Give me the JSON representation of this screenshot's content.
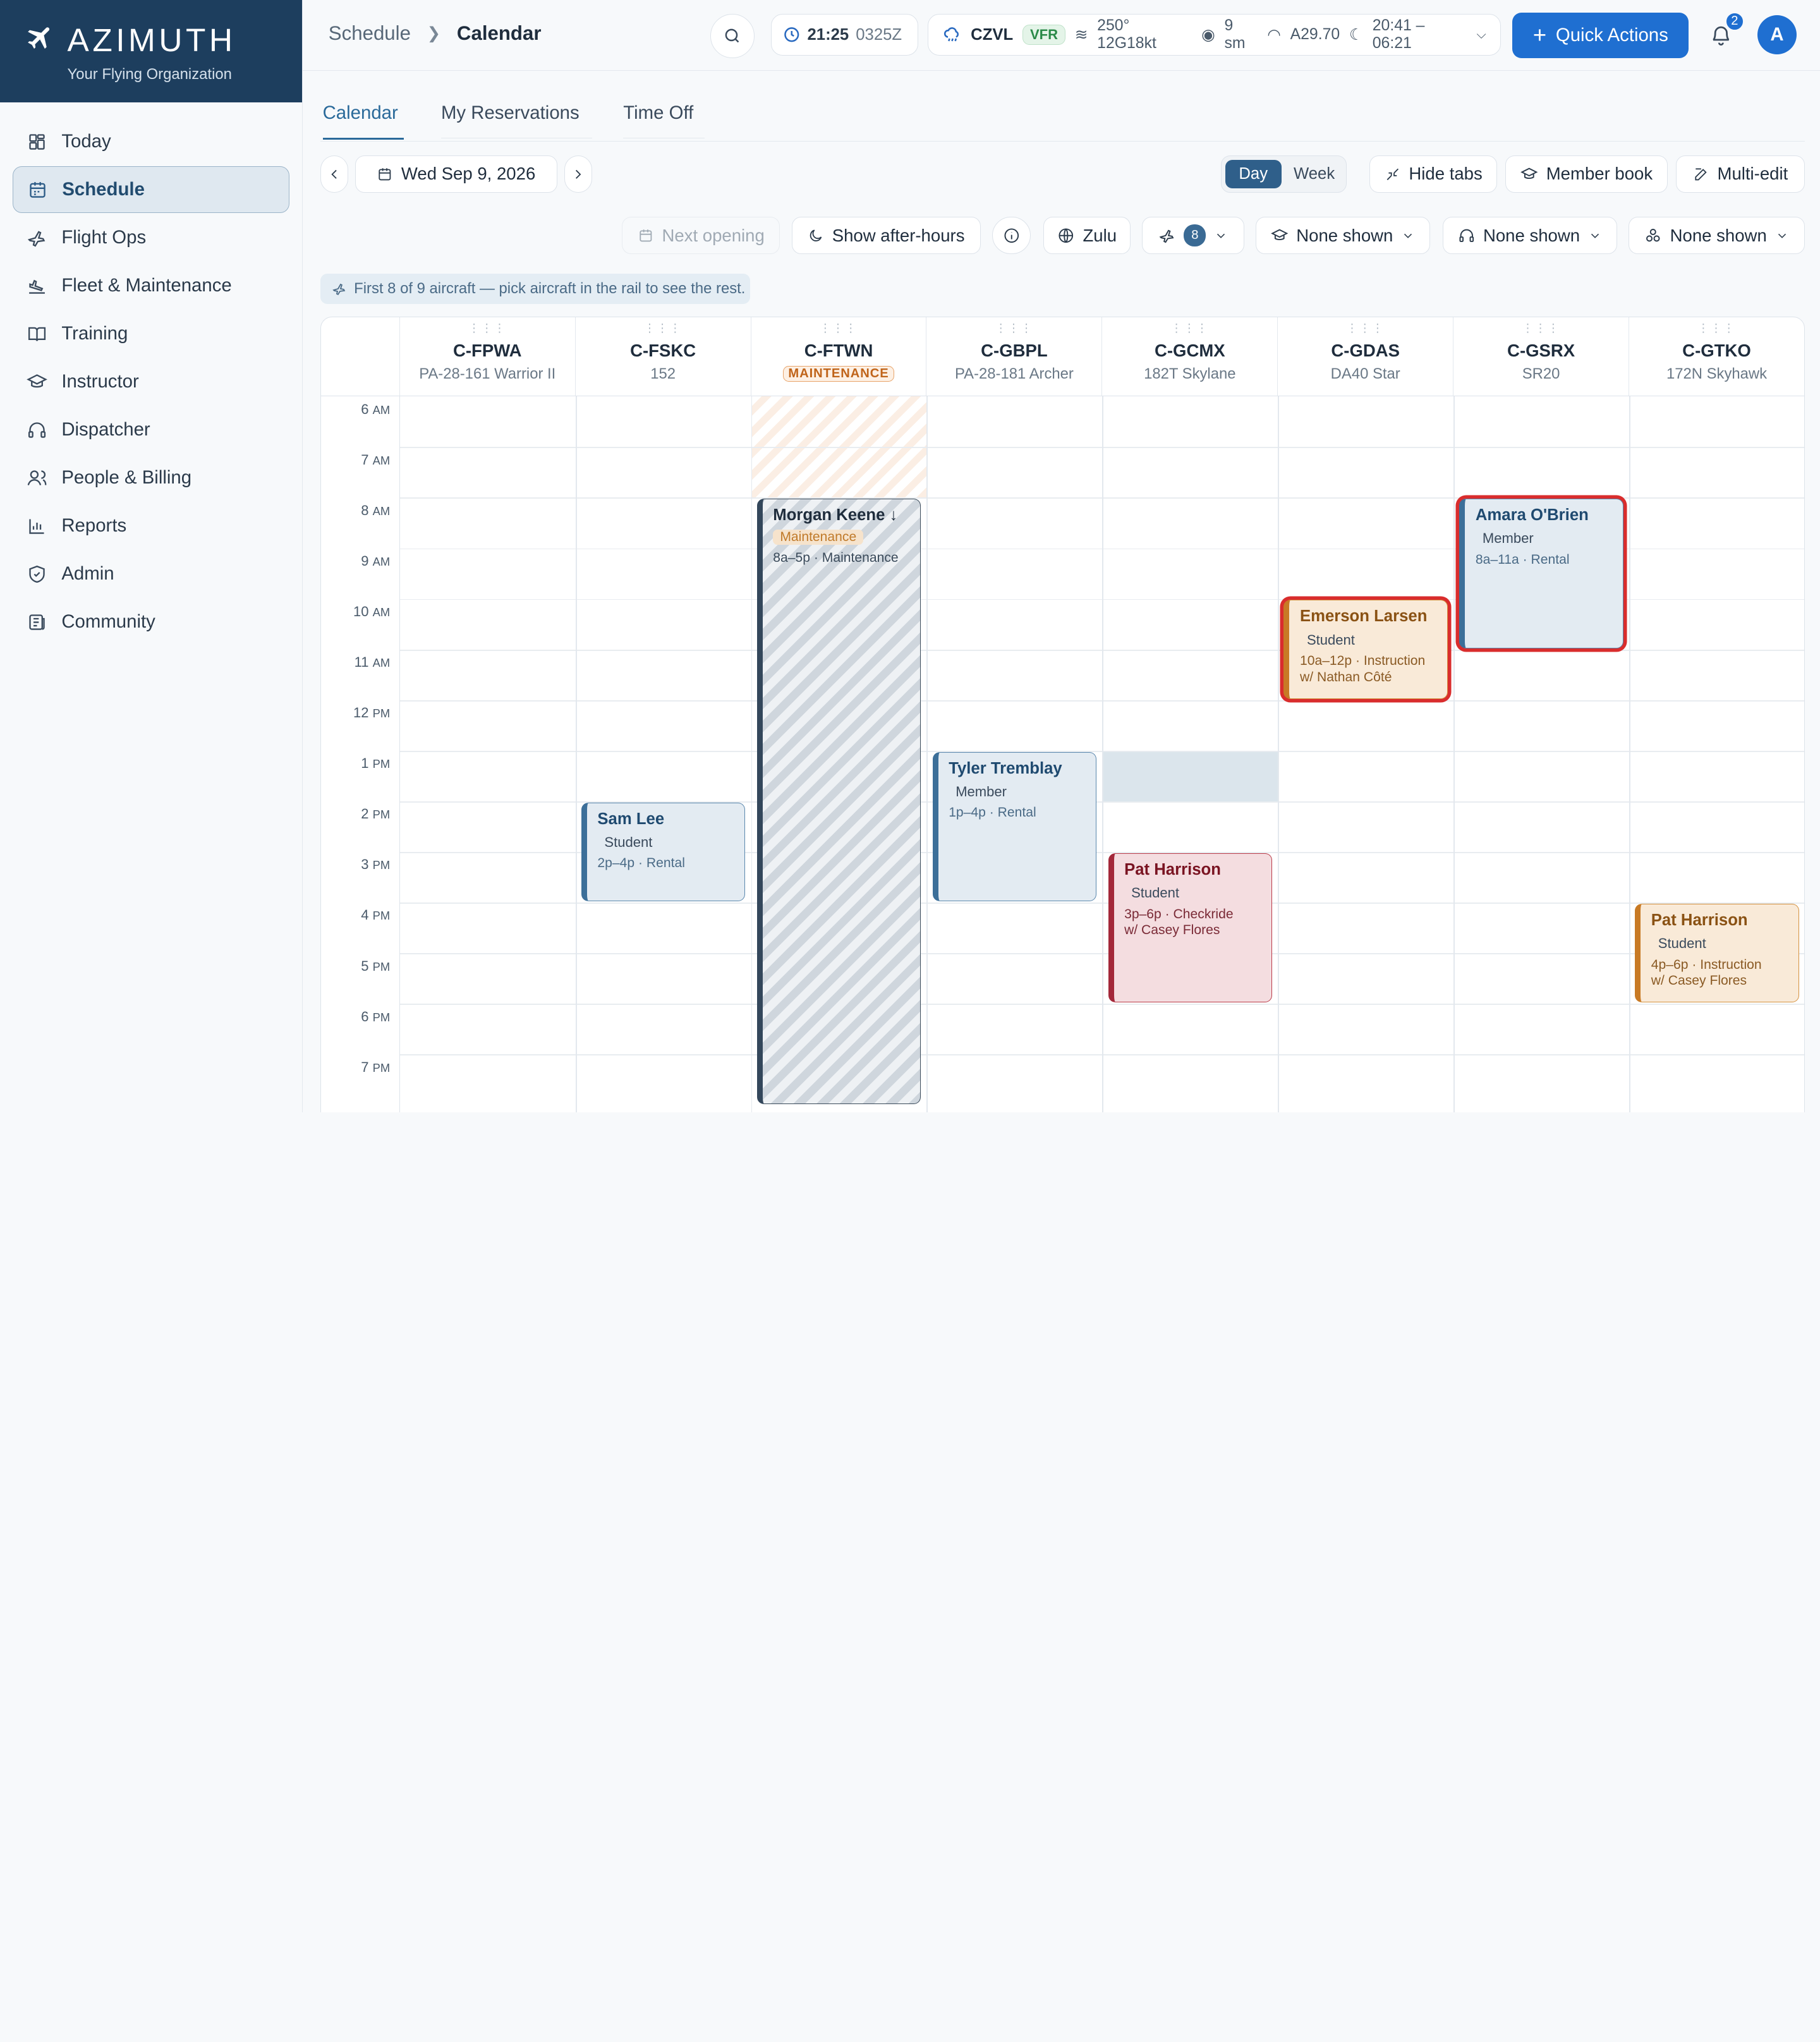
{
  "brand": {
    "name": "AZIMUTH",
    "subtitle": "Your Flying Organization"
  },
  "nav": [
    {
      "label": "Today",
      "icon": "dashboard-icon"
    },
    {
      "label": "Schedule",
      "icon": "calendar-icon",
      "active": true
    },
    {
      "label": "Flight Ops",
      "icon": "plane-icon"
    },
    {
      "label": "Fleet & Maintenance",
      "icon": "plane-landing-icon"
    },
    {
      "label": "Training",
      "icon": "book-icon"
    },
    {
      "label": "Instructor",
      "icon": "graduation-cap-icon"
    },
    {
      "label": "Dispatcher",
      "icon": "headset-icon"
    },
    {
      "label": "People & Billing",
      "icon": "users-icon"
    },
    {
      "label": "Reports",
      "icon": "bar-chart-icon"
    },
    {
      "label": "Admin",
      "icon": "shield-icon"
    },
    {
      "label": "Community",
      "icon": "newspaper-icon"
    }
  ],
  "breadcrumb": {
    "parent": "Schedule",
    "current": "Calendar"
  },
  "clock": {
    "local": "21:25",
    "zulu": "0325Z"
  },
  "weather": {
    "station": "CZVL",
    "category": "VFR",
    "wind": "250° 12G18kt",
    "visibility": "9 sm",
    "altimeter": "A29.70",
    "sun": "20:41 – 06:21"
  },
  "quick_actions_label": "Quick Actions",
  "notifications_count": "2",
  "avatar_initial": "A",
  "tabs": [
    "Calendar",
    "My Reservations",
    "Time Off"
  ],
  "date_label": "Wed Sep 9, 2026",
  "view_toggle": {
    "day": "Day",
    "week": "Week"
  },
  "toolbar": {
    "hide_tabs": "Hide tabs",
    "member_book": "Member book",
    "multi_edit": "Multi-edit"
  },
  "filters": {
    "next_opening": "Next opening",
    "after_hours": "Show after-hours",
    "zulu": "Zulu",
    "aircraft_count": "8",
    "instructors": "None shown",
    "dispatchers": "None shown",
    "resources": "None shown"
  },
  "notice": "First 8 of 9 aircraft — pick aircraft in the rail to see the rest.",
  "grid_handle": "⋮⋮⋮",
  "aircraft": [
    {
      "reg": "C-FPWA",
      "model": "PA-28-161 Warrior II"
    },
    {
      "reg": "C-FSKC",
      "model": "152"
    },
    {
      "reg": "C-FTWN",
      "model": "",
      "status": "MAINTENANCE"
    },
    {
      "reg": "C-GBPL",
      "model": "PA-28-181 Archer"
    },
    {
      "reg": "C-GCMX",
      "model": "182T Skylane"
    },
    {
      "reg": "C-GDAS",
      "model": "DA40 Star"
    },
    {
      "reg": "C-GSRX",
      "model": "SR20"
    },
    {
      "reg": "C-GTKO",
      "model": "172N Skyhawk"
    }
  ],
  "hours": [
    {
      "h": "6",
      "ap": "AM"
    },
    {
      "h": "7",
      "ap": "AM"
    },
    {
      "h": "8",
      "ap": "AM"
    },
    {
      "h": "9",
      "ap": "AM"
    },
    {
      "h": "10",
      "ap": "AM"
    },
    {
      "h": "11",
      "ap": "AM"
    },
    {
      "h": "12",
      "ap": "PM"
    },
    {
      "h": "1",
      "ap": "PM"
    },
    {
      "h": "2",
      "ap": "PM"
    },
    {
      "h": "3",
      "ap": "PM"
    },
    {
      "h": "4",
      "ap": "PM"
    },
    {
      "h": "5",
      "ap": "PM"
    },
    {
      "h": "6",
      "ap": "PM"
    },
    {
      "h": "7",
      "ap": "PM"
    }
  ],
  "events": [
    {
      "col": 1,
      "start": 14,
      "end": 16,
      "name": "Sam Lee",
      "role": "Student",
      "detail": "2p–4p · Rental",
      "style": "blue"
    },
    {
      "col": 2,
      "start": 8,
      "end": 20,
      "name": "Morgan Keene ↓",
      "role": "Maintenance",
      "detail": "8a–5p · Maintenance",
      "style": "maint"
    },
    {
      "col": 3,
      "start": 13,
      "end": 16,
      "name": "Tyler Tremblay",
      "role": "Member",
      "detail": "1p–4p · Rental",
      "style": "blue"
    },
    {
      "col": 4,
      "start": 15,
      "end": 18,
      "name": "Pat Harrison",
      "role": "Student",
      "detail": "3p–6p · Checkride",
      "detail2": "w/ Casey Flores",
      "style": "red"
    },
    {
      "col": 5,
      "start": 10,
      "end": 12,
      "name": "Emerson Larsen",
      "role": "Student",
      "detail": "10a–12p · Instruction",
      "detail2": "w/ Nathan Côté",
      "style": "orange",
      "selected": true
    },
    {
      "col": 6,
      "start": 8,
      "end": 11,
      "name": "Amara O'Brien",
      "role": "Member",
      "detail": "8a–11a · Rental",
      "style": "blue",
      "selected": true
    },
    {
      "col": 7,
      "start": 16,
      "end": 18,
      "name": "Pat Harrison",
      "role": "Student",
      "detail": "4p–6p · Instruction",
      "detail2": "w/ Casey Flores",
      "style": "orange"
    }
  ],
  "maintenance_stripe": {
    "col": 2,
    "start": 6,
    "end": 8
  },
  "shaded_blocks": [
    {
      "col": 4,
      "start": 13,
      "end": 14
    }
  ]
}
